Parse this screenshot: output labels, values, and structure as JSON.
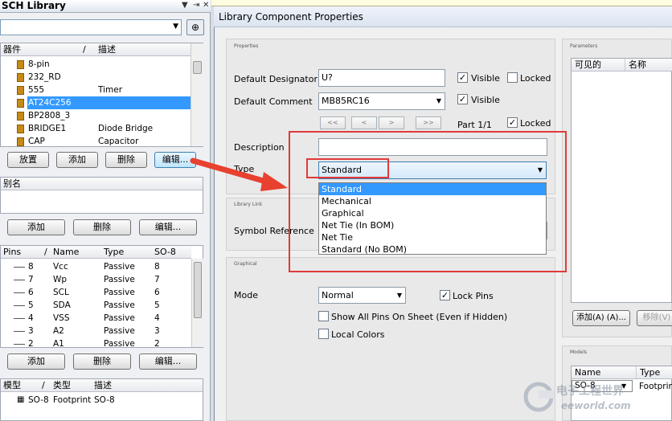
{
  "left_panel": {
    "title": "SCH Library",
    "top_icons": [
      "▼",
      "⇥",
      "✕"
    ],
    "components_grid": {
      "headers": [
        "器件",
        "/",
        "描述"
      ],
      "rows": [
        {
          "name": "8-pin",
          "desc": ""
        },
        {
          "name": "232_RD",
          "desc": ""
        },
        {
          "name": "555",
          "desc": "Timer"
        },
        {
          "name": "AT24C256",
          "desc": "",
          "selected": true
        },
        {
          "name": "BP2808_3",
          "desc": ""
        },
        {
          "name": "BRIDGE1",
          "desc": "Diode Bridge"
        },
        {
          "name": "CAP",
          "desc": "Capacitor"
        }
      ]
    },
    "component_buttons": [
      "放置",
      "添加",
      "删除",
      "编辑..."
    ],
    "alias_header": "别名",
    "alias_buttons": [
      "添加",
      "删除",
      "编辑..."
    ],
    "pins_grid": {
      "headers": [
        "Pins",
        "/",
        "Name",
        "Type",
        "SO-8"
      ],
      "rows": [
        {
          "pin": "8",
          "name": "Vcc",
          "type": "Passive",
          "so": "8"
        },
        {
          "pin": "7",
          "name": "Wp",
          "type": "Passive",
          "so": "7"
        },
        {
          "pin": "6",
          "name": "SCL",
          "type": "Passive",
          "so": "6"
        },
        {
          "pin": "5",
          "name": "SDA",
          "type": "Passive",
          "so": "5"
        },
        {
          "pin": "4",
          "name": "VSS",
          "type": "Passive",
          "so": "4"
        },
        {
          "pin": "3",
          "name": "A2",
          "type": "Passive",
          "so": "3"
        },
        {
          "pin": "2",
          "name": "A1",
          "type": "Passive",
          "so": "2"
        }
      ]
    },
    "pin_buttons": [
      "添加",
      "删除",
      "编辑..."
    ],
    "model_grid": {
      "headers": [
        "模型",
        "/",
        "类型",
        "描述"
      ],
      "rows": [
        {
          "model": "SO-8",
          "type": "Footprint",
          "desc": "SO-8"
        }
      ]
    }
  },
  "dialog": {
    "title": "Library Component Properties",
    "properties_caption": "Properties",
    "default_designator_label": "Default Designator",
    "default_designator_value": "U?",
    "default_comment_label": "Default Comment",
    "default_comment_value": "MB85RC16",
    "visible_label": "Visible",
    "locked_label": "Locked",
    "nav_buttons": [
      "<<",
      "<",
      ">",
      ">>"
    ],
    "part_label": "Part 1/1",
    "description_label": "Description",
    "description_value": "",
    "type_label": "Type",
    "type_value": "Standard",
    "type_options": [
      "Standard",
      "Mechanical",
      "Graphical",
      "Net Tie (In BOM)",
      "Net Tie",
      "Standard (No BOM)"
    ],
    "library_link_caption": "Library Link",
    "symbol_reference_label": "Symbol Reference",
    "graphical_caption": "Graphical",
    "mode_label": "Mode",
    "mode_value": "Normal",
    "lock_pins_label": "Lock Pins",
    "show_all_pins_label": "Show All Pins On Sheet (Even if Hidden)",
    "local_colors_label": "Local Colors",
    "parameters_caption": "Parameters",
    "parameters_headers": [
      "可见的",
      "名称"
    ],
    "add_param_button": "添加(A) (A)...",
    "remove_param_button": "移除(V)",
    "models_caption": "Models",
    "models_headers": [
      "Name",
      "Type"
    ],
    "models_row": {
      "name": "SO-8",
      "type": "Footprint"
    }
  },
  "watermark": {
    "text": "电子工程世界",
    "url": "eeworld.com"
  },
  "colors": {
    "selection": "#3399ff",
    "highlight_box": "#e03a3a",
    "arrow": "#e8412f"
  }
}
